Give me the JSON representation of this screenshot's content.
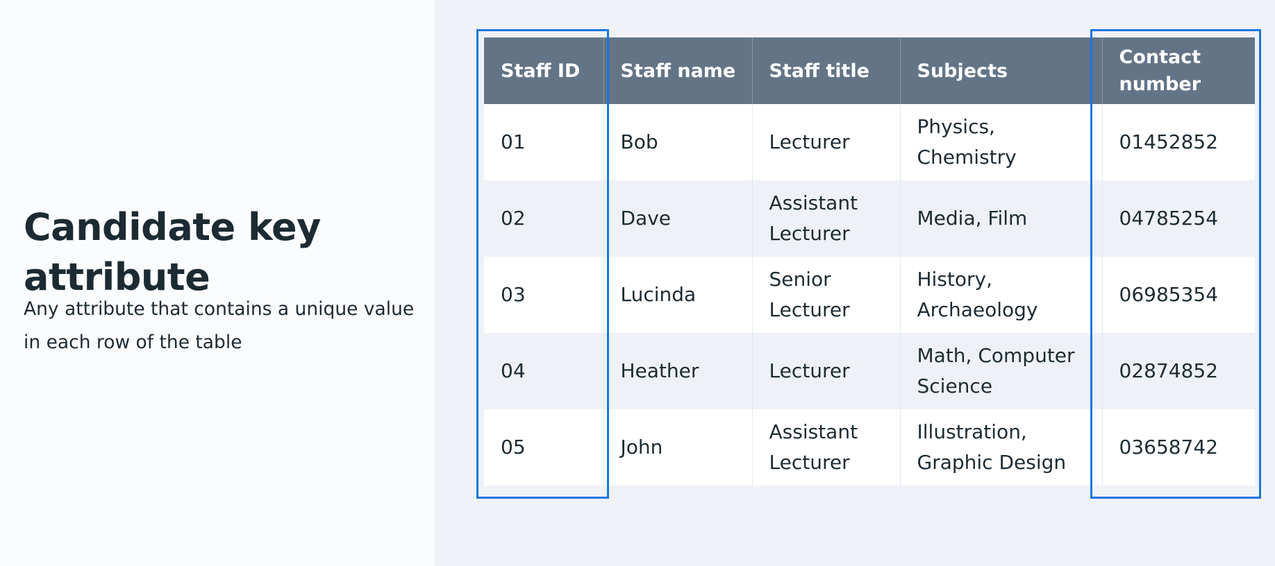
{
  "heading": {
    "title": "Candidate key attribute",
    "description": "Any attribute that contains a unique value in each row of the table"
  },
  "table": {
    "columns": [
      "Staff ID",
      "Staff name",
      "Staff title",
      "Subjects",
      "Contact number"
    ],
    "rows": [
      [
        "01",
        "Bob",
        "Lecturer",
        "Physics, Chemistry",
        "01452852"
      ],
      [
        "02",
        "Dave",
        "Assistant Lecturer",
        "Media, Film",
        "04785254"
      ],
      [
        "03",
        "Lucinda",
        "Senior Lecturer",
        "History, Archaeology",
        "06985354"
      ],
      [
        "04",
        "Heather",
        "Lecturer",
        "Math, Computer Science",
        "02874852"
      ],
      [
        "05",
        "John",
        "Assistant Lecturer",
        "Illustration, Graphic Design",
        "03658742"
      ]
    ]
  },
  "highlighted_columns": [
    "Staff ID",
    "Contact number"
  ],
  "colors": {
    "header_background": "#637487",
    "highlight_outline": "#1b76e0",
    "text": "#1c2b33"
  }
}
